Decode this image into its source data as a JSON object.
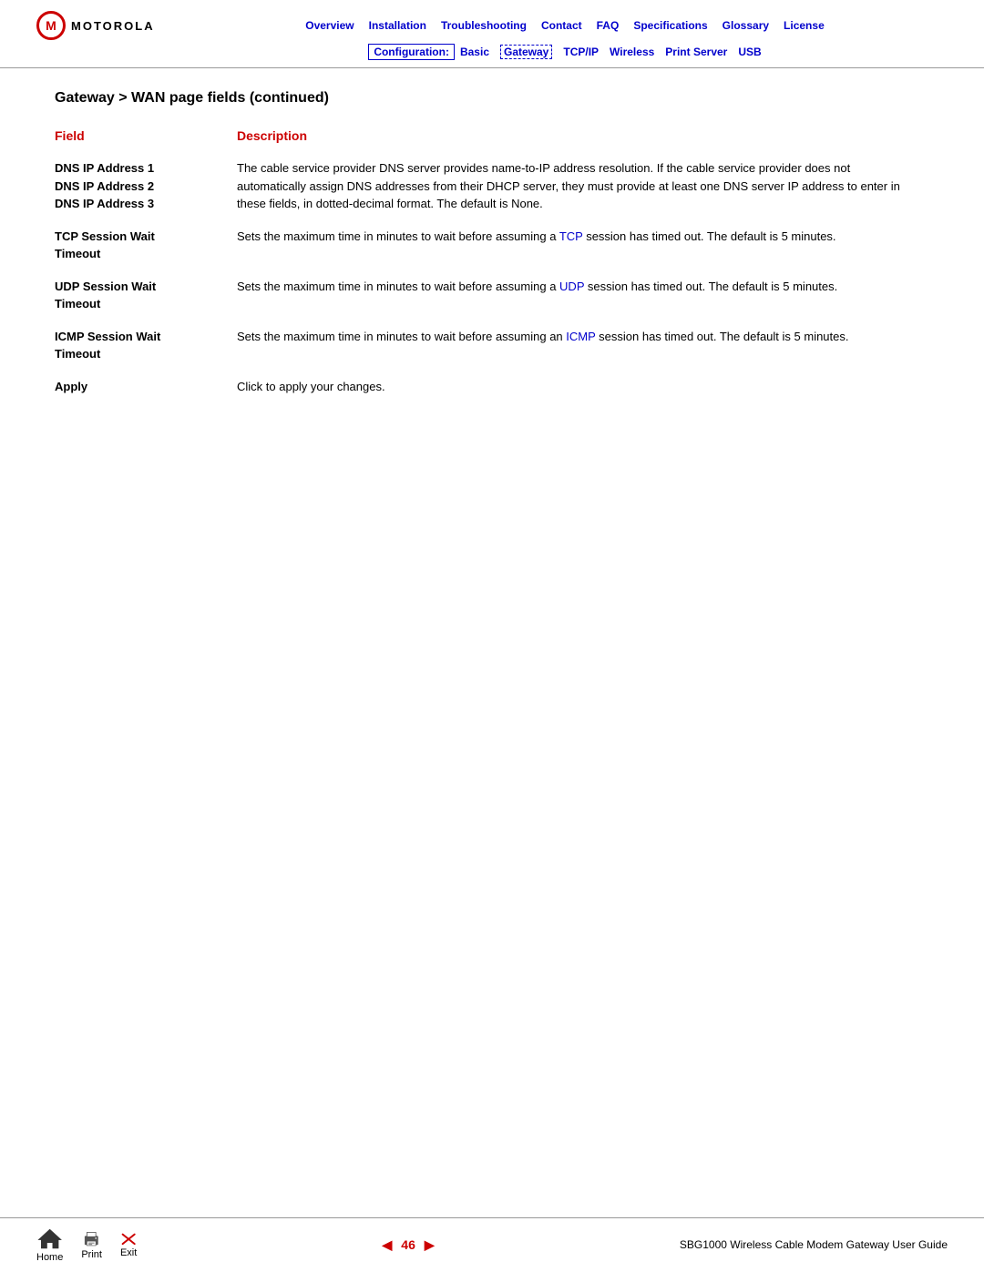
{
  "header": {
    "logo_text": "MOTOROLA",
    "nav": {
      "items": [
        {
          "label": "Overview",
          "href": "#"
        },
        {
          "label": "Installation",
          "href": "#"
        },
        {
          "label": "Troubleshooting",
          "href": "#"
        },
        {
          "label": "Contact",
          "href": "#"
        },
        {
          "label": "FAQ",
          "href": "#"
        },
        {
          "label": "Specifications",
          "href": "#"
        },
        {
          "label": "Glossary",
          "href": "#"
        },
        {
          "label": "License",
          "href": "#"
        }
      ]
    },
    "subnav": {
      "config_label": "Configuration:",
      "items": [
        {
          "label": "Basic",
          "active": false
        },
        {
          "label": "Gateway",
          "active": true
        },
        {
          "label": "TCP/IP",
          "active": false
        },
        {
          "label": "Wireless",
          "active": false
        },
        {
          "label": "Print Server",
          "active": false
        },
        {
          "label": "USB",
          "active": false
        }
      ]
    }
  },
  "page": {
    "title": "Gateway > WAN page fields (continued)",
    "table": {
      "col1_header": "Field",
      "col2_header": "Description",
      "rows": [
        {
          "id": "dns",
          "field_lines": [
            "DNS IP Address 1",
            "DNS IP Address 2",
            "DNS IP Address 3"
          ],
          "description": "The cable service provider DNS server provides name-to-IP address resolution. If the cable service provider does not automatically assign DNS addresses from their DHCP server, they must provide at least one DNS server IP address to enter in these fields, in dotted-decimal format. The default is None.",
          "links": []
        },
        {
          "id": "tcp",
          "field_lines": [
            "TCP Session Wait",
            "Timeout"
          ],
          "description_parts": [
            {
              "text": "Sets the maximum time in minutes to wait before assuming a "
            },
            {
              "text": "TCP",
              "link": true
            },
            {
              "text": " session has timed out. The default is 5 minutes."
            }
          ]
        },
        {
          "id": "udp",
          "field_lines": [
            "UDP Session Wait",
            "Timeout"
          ],
          "description_parts": [
            {
              "text": "Sets the maximum time in minutes to wait before assuming a "
            },
            {
              "text": "UDP",
              "link": true
            },
            {
              "text": " session has timed out. The default is 5 minutes."
            }
          ]
        },
        {
          "id": "icmp",
          "field_lines": [
            "ICMP Session Wait",
            "Timeout"
          ],
          "description_parts": [
            {
              "text": "Sets the maximum time in minutes to wait before assuming an "
            },
            {
              "text": "ICMP",
              "link": true
            },
            {
              "text": " session has timed out. The default is 5 minutes."
            }
          ]
        },
        {
          "id": "apply",
          "field_lines": [
            "Apply"
          ],
          "description": "Click to apply your changes.",
          "description_parts": []
        }
      ]
    }
  },
  "footer": {
    "home_label": "Home",
    "print_label": "Print",
    "exit_label": "Exit",
    "page_number": "46",
    "guide_title": "SBG1000 Wireless Cable Modem Gateway User Guide"
  }
}
